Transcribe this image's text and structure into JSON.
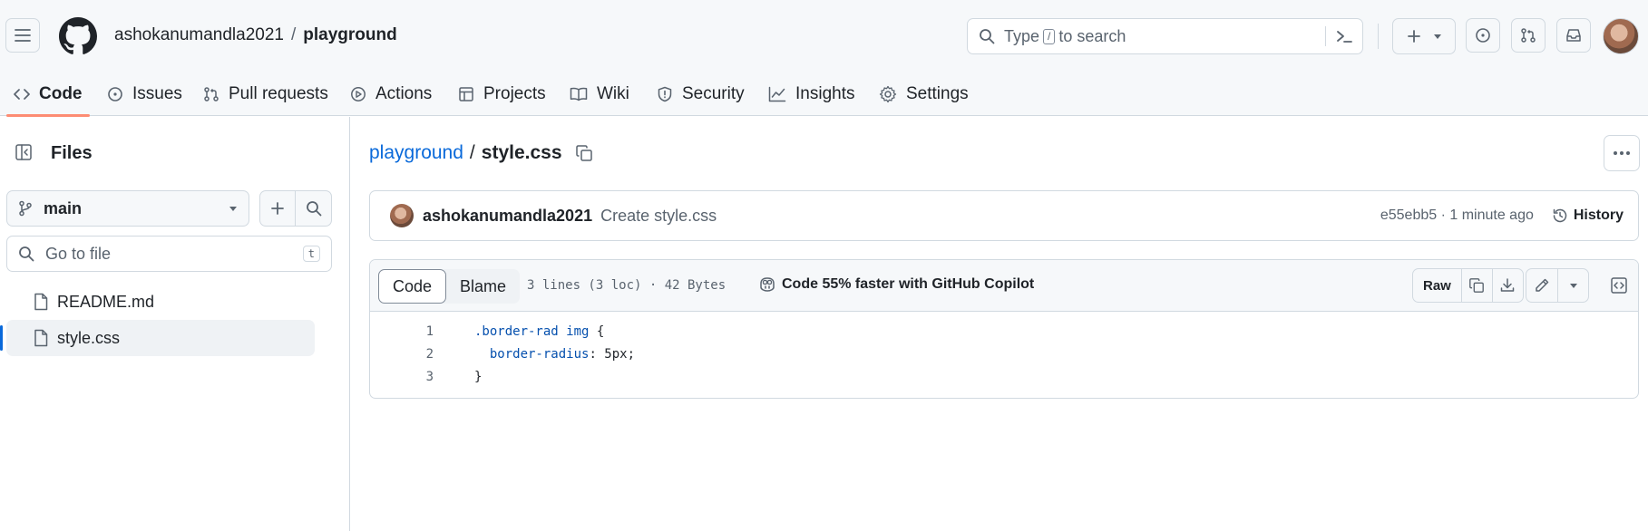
{
  "header": {
    "owner": "ashokanumandla2021",
    "separator": "/",
    "repo": "playground",
    "search": {
      "before": "Type",
      "key": "/",
      "after": "to search"
    }
  },
  "tabs": [
    {
      "label": "Code",
      "icon": "code-icon"
    },
    {
      "label": "Issues",
      "icon": "issue-icon"
    },
    {
      "label": "Pull requests",
      "icon": "pull-request-icon"
    },
    {
      "label": "Actions",
      "icon": "play-icon"
    },
    {
      "label": "Projects",
      "icon": "table-icon"
    },
    {
      "label": "Wiki",
      "icon": "book-icon"
    },
    {
      "label": "Security",
      "icon": "shield-icon"
    },
    {
      "label": "Insights",
      "icon": "graph-icon"
    },
    {
      "label": "Settings",
      "icon": "gear-icon"
    }
  ],
  "sidebar": {
    "title": "Files",
    "branch": "main",
    "go_to_file_placeholder": "Go to file",
    "go_to_file_shortcut": "t",
    "files": [
      {
        "name": "README.md",
        "selected": false
      },
      {
        "name": "style.css",
        "selected": true
      }
    ]
  },
  "main": {
    "breadcrumb_repo": "playground",
    "breadcrumb_sep": "/",
    "breadcrumb_file": "style.css",
    "commit": {
      "author": "ashokanumandla2021",
      "message": "Create style.css",
      "meta": "e55ebb5 · 1 minute ago",
      "history_label": "History"
    },
    "file": {
      "view_code": "Code",
      "view_blame": "Blame",
      "meta": "3 lines (3 loc) · 42 Bytes",
      "copilot": "Code 55% faster with GitHub Copilot",
      "raw_label": "Raw",
      "lines": [
        {
          "n": "1",
          "selector": ".border-rad img",
          "rest": " {",
          "prop": "",
          "value": ""
        },
        {
          "n": "2",
          "selector": "",
          "rest": "",
          "prop": "  border-radius",
          "value": ": 5px;"
        },
        {
          "n": "3",
          "selector": "",
          "rest": "}",
          "prop": "",
          "value": ""
        }
      ]
    }
  },
  "colors": {
    "accent": "#0969da",
    "tab_underline": "#fd8c73",
    "muted": "#59636e"
  }
}
